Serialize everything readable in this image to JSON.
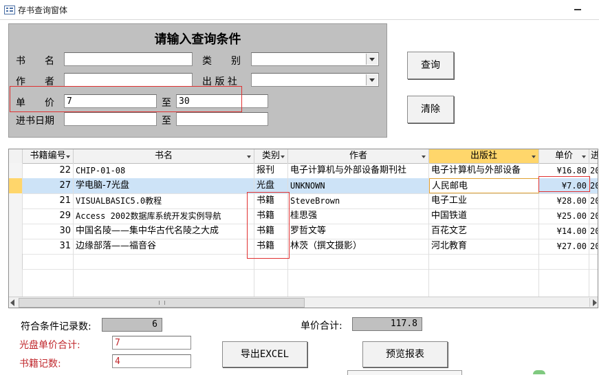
{
  "window": {
    "title": "存书查询窗体"
  },
  "criteria": {
    "title": "请输入查询条件",
    "name_label": "书　　名",
    "category_label": "类　　别",
    "author_label": "作　　者",
    "publisher_label": "出 版 社",
    "price_label": "单　　价",
    "date_label": "进书日期",
    "to_label": "至",
    "name_value": "",
    "category_value": "",
    "author_value": "",
    "publisher_value": "",
    "price_from": "7",
    "price_to": "30",
    "date_from": "",
    "date_to": ""
  },
  "buttons": {
    "query": "查询",
    "clear": "清除",
    "export": "导出EXCEL",
    "preview": "预览报表"
  },
  "table": {
    "columns": [
      "书籍编号",
      "书名",
      "类别",
      "作者",
      "出版社",
      "单价",
      "进"
    ],
    "rows": [
      {
        "id": "22",
        "name": "CHIP-01-08",
        "category": "报刊",
        "author": "电子计算机与外部设备期刊社",
        "publisher": "电子计算机与外部设备",
        "price": "¥16.80",
        "date": "20"
      },
      {
        "id": "27",
        "name": "学电脑-7光盘",
        "category": "光盘",
        "author": "UNKNOWN",
        "publisher": "人民邮电",
        "price": "¥7.00",
        "date": "20"
      },
      {
        "id": "21",
        "name": "VISUALBASIC5.0教程",
        "category": "书籍",
        "author": "SteveBrown",
        "publisher": "电子工业",
        "price": "¥28.00",
        "date": "20"
      },
      {
        "id": "29",
        "name": "Access 2002数据库系统开发实例导航",
        "category": "书籍",
        "author": "桂思强",
        "publisher": "中国铁道",
        "price": "¥25.00",
        "date": "20"
      },
      {
        "id": "30",
        "name": "中国名陵——集中华古代名陵之大成",
        "category": "书籍",
        "author": "罗哲文等",
        "publisher": "百花文艺",
        "price": "¥14.00",
        "date": "20"
      },
      {
        "id": "31",
        "name": "边缘部落——福音谷",
        "category": "书籍",
        "author": "林茨（撰文摄影）",
        "publisher": "河北教育",
        "price": "¥27.00",
        "date": "20"
      }
    ]
  },
  "summary": {
    "count_label": "符合条件记录数:",
    "count_value": "6",
    "price_total_label": "单价合计:",
    "price_total_value": "117.8",
    "disc_total_label": "光盘单价合计:",
    "disc_total_value": "7",
    "book_count_label": "书籍记数:",
    "book_count_value": "4"
  },
  "colors": {
    "highlight": "#ffd66b",
    "selected_row": "#cde3f7",
    "panel": "#c0c0c0",
    "annotation": "#e03030"
  }
}
